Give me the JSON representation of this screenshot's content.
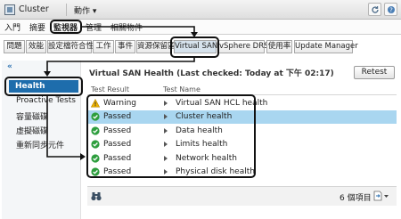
{
  "window": {
    "title": "Cluster",
    "actions_label": "動作 ▾"
  },
  "nav_tabs": [
    "入門",
    "摘要",
    "監視器",
    "管理",
    "相關物件"
  ],
  "sub_tabs": [
    "問題",
    "效能",
    "設定檔符合性",
    "工作",
    "事件",
    "資源保留區",
    "Virtual SAN",
    "vSphere DRS",
    "使用率",
    "Update Manager"
  ],
  "sidebar": {
    "collapse_label": "«",
    "items": [
      "Health",
      "Proactive Tests",
      "容量磁碟",
      "虛擬磁碟",
      "重新同步元件"
    ]
  },
  "main": {
    "title": "Virtual SAN Health (Last checked: Today at 下午 02:17)",
    "retest_label": "Retest",
    "columns": [
      "Test Result",
      "Test Name"
    ],
    "rows": [
      {
        "result": "Warning",
        "name": "Virtual SAN HCL health"
      },
      {
        "result": "Passed",
        "name": "Cluster health"
      },
      {
        "result": "Passed",
        "name": "Data health"
      },
      {
        "result": "Passed",
        "name": "Limits health"
      },
      {
        "result": "Passed",
        "name": "Network health"
      },
      {
        "result": "Passed",
        "name": "Physical disk health"
      }
    ],
    "item_count": "6 個項目"
  },
  "colors": {
    "accent": "#1e6dac",
    "row_selected": "#a9d6f0",
    "passed": "#2e9e3e",
    "warning": "#f0b400"
  }
}
